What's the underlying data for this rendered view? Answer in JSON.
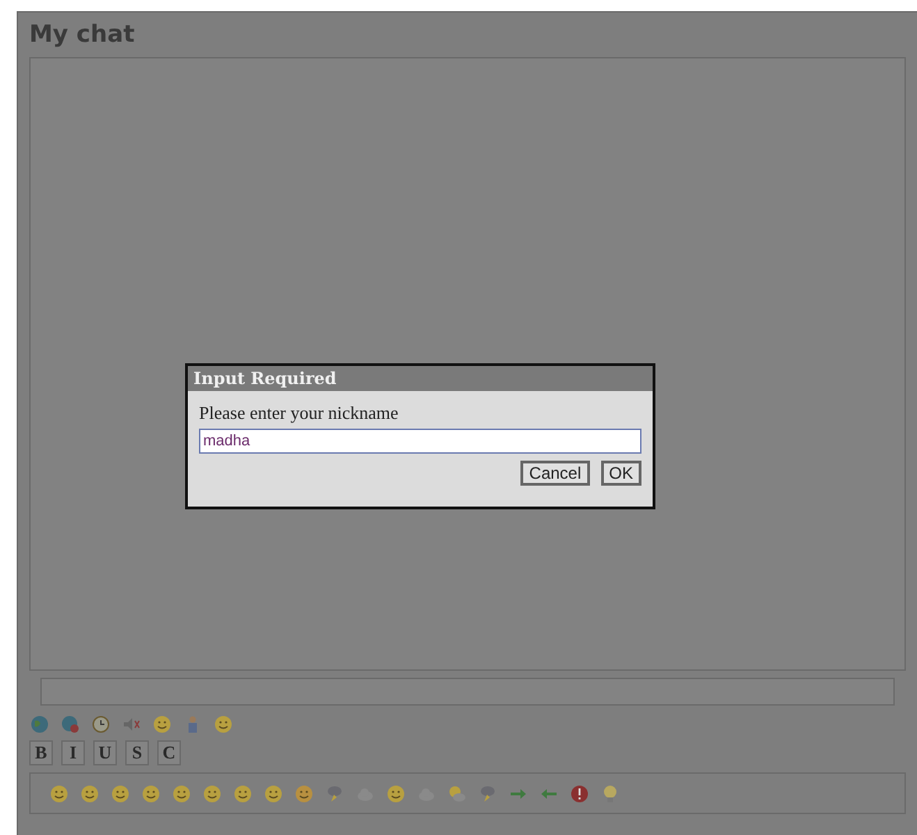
{
  "window": {
    "title": "My chat"
  },
  "dialog": {
    "title": "Input Required",
    "prompt": "Please enter your nickname",
    "value": "madha",
    "buttons": [
      {
        "label": "Cancel"
      },
      {
        "label": "OK"
      }
    ]
  },
  "format_buttons": [
    {
      "label": "B"
    },
    {
      "label": "I"
    },
    {
      "label": "U"
    },
    {
      "label": "S"
    },
    {
      "label": "C"
    }
  ]
}
